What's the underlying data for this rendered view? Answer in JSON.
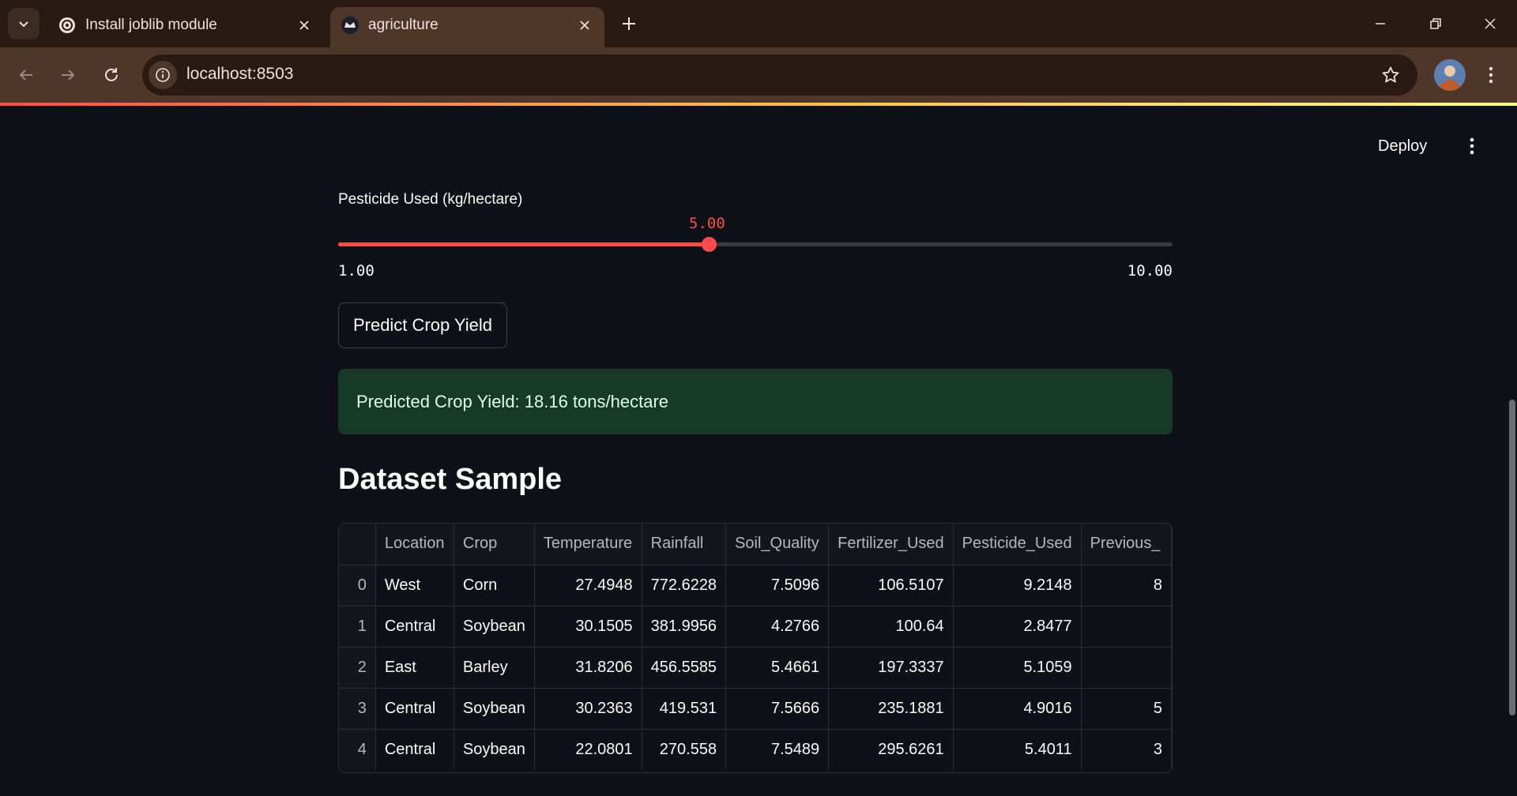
{
  "browser": {
    "tabs": [
      {
        "title": "Install joblib module",
        "icon": "openai-icon"
      },
      {
        "title": "agriculture",
        "icon": "streamlit-crown-icon"
      }
    ],
    "url": "localhost:8503"
  },
  "app": {
    "deploy_label": "Deploy",
    "slider": {
      "label": "Pesticide Used (kg/hectare)",
      "value": "5.00",
      "min": "1.00",
      "max": "10.00",
      "fraction": 0.4444
    },
    "predict_button": "Predict Crop Yield",
    "result": "Predicted Crop Yield: 18.16 tons/hectare",
    "heading": "Dataset Sample",
    "table": {
      "columns": [
        "",
        "Location",
        "Crop",
        "Temperature",
        "Rainfall",
        "Soil_Quality",
        "Fertilizer_Used",
        "Pesticide_Used",
        "Previous_"
      ],
      "rows": [
        [
          "0",
          "West",
          "Corn",
          "27.4948",
          "772.6228",
          "7.5096",
          "106.5107",
          "9.2148",
          "8"
        ],
        [
          "1",
          "Central",
          "Soybean",
          "30.1505",
          "381.9956",
          "4.2766",
          "100.64",
          "2.8477",
          ""
        ],
        [
          "2",
          "East",
          "Barley",
          "31.8206",
          "456.5585",
          "5.4661",
          "197.3337",
          "5.1059",
          ""
        ],
        [
          "3",
          "Central",
          "Soybean",
          "30.2363",
          "419.531",
          "7.5666",
          "235.1881",
          "4.9016",
          "5"
        ],
        [
          "4",
          "Central",
          "Soybean",
          "22.0801",
          "270.558",
          "7.5489",
          "295.6261",
          "5.4011",
          "3"
        ]
      ]
    }
  },
  "colors": {
    "accent": "#ff4b4b",
    "background": "#0e1117",
    "success_bg": "#173928"
  }
}
